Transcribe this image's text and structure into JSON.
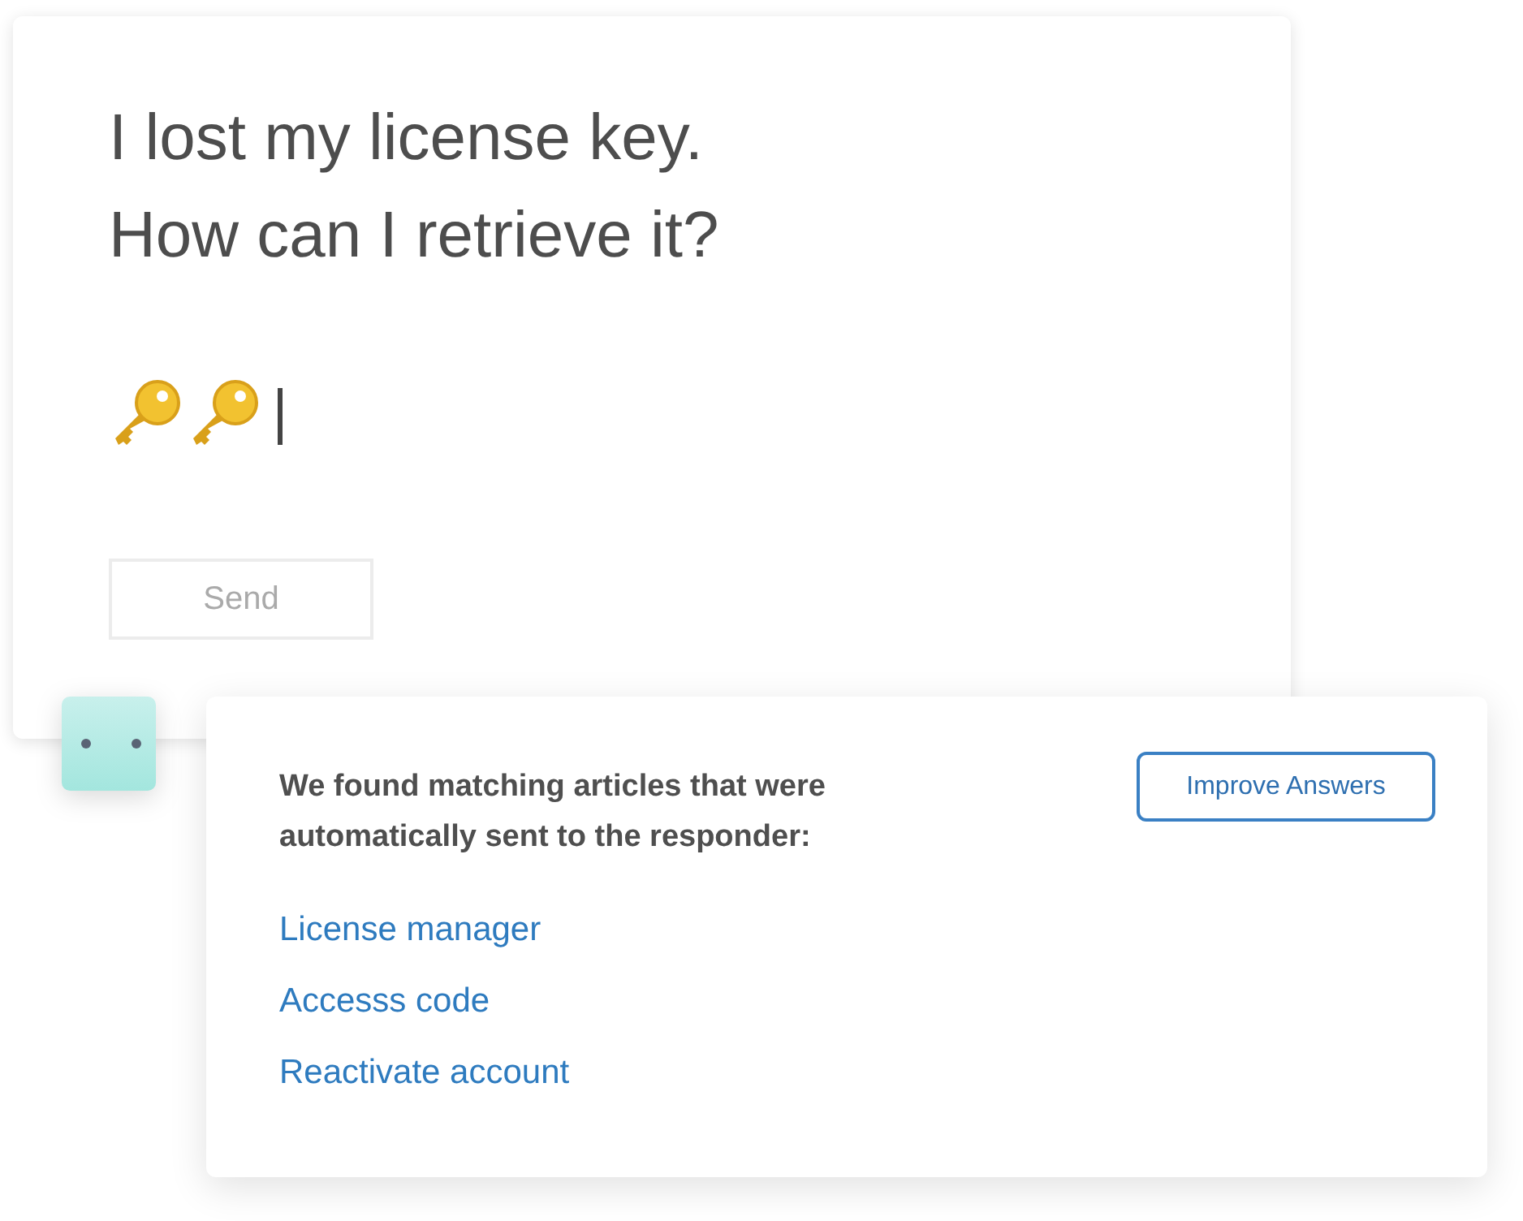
{
  "composer": {
    "lines": [
      "I lost my license key.",
      "How can I retrieve it?"
    ],
    "send_button": {
      "label": "Send",
      "disabled": true
    }
  },
  "suggestions": {
    "message": "We found matching articles that were automatically sent to the responder:",
    "button": "Improve Answers",
    "articles": [
      "License manager",
      "Accesss code",
      "Reactivate account"
    ]
  }
}
